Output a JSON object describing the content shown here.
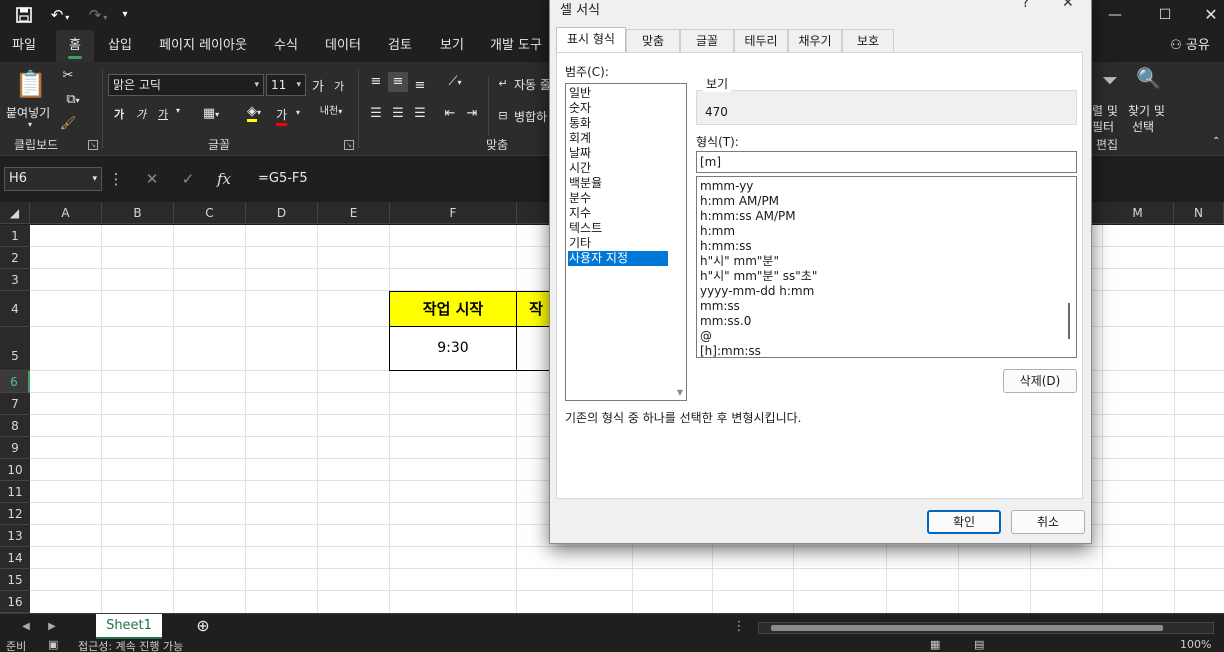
{
  "quick_access": {
    "save_icon": "save-icon",
    "undo_icon": "undo-icon",
    "redo_icon": "redo-icon",
    "customize_icon": "chevron-down-icon"
  },
  "ribbon_tabs": [
    "파일",
    "홈",
    "삽입",
    "페이지 레이아웃",
    "수식",
    "데이터",
    "검토",
    "보기",
    "개발 도구"
  ],
  "share_label": "공유",
  "clipboard": {
    "paste_label": "붙여넣기",
    "group_label": "클립보드"
  },
  "font": {
    "name": "맑은 고딕",
    "size": "11",
    "grow": "가",
    "shrink": "가",
    "bold": "가",
    "italic": "가",
    "underline": "가",
    "red_text": "가",
    "group_label": "글꼴"
  },
  "alignment": {
    "wrap_label": "자동 줄",
    "merge_label": "병합하",
    "group_label": "맞춤"
  },
  "editing": {
    "sort_filter": "렬 및",
    "filter_sub": "필터",
    "find_select": "찾기 및",
    "select_sub": "선택",
    "group_label": "편집"
  },
  "formula_bar": {
    "name_box": "H6",
    "cancel": "✕",
    "enter": "✓",
    "fx": "fx",
    "formula": "=G5-F5"
  },
  "columns": [
    "A",
    "B",
    "C",
    "D",
    "E",
    "F",
    "",
    "",
    "",
    "",
    "",
    "",
    "",
    "",
    "M",
    "N"
  ],
  "rows": [
    "1",
    "2",
    "3",
    "4",
    "5",
    "6",
    "7",
    "8",
    "9",
    "10",
    "11",
    "12",
    "13",
    "14",
    "15",
    "16"
  ],
  "cells": {
    "f4": "작업 시작",
    "g4_partial": "작",
    "f5": "9:30"
  },
  "sheet_tabs": [
    "Sheet1"
  ],
  "status": {
    "ready": "준비",
    "accessibility": "접근성: 계속 진행 가능",
    "zoom": "100%"
  },
  "dialog": {
    "title": "셀 서식",
    "help": "?",
    "close": "✕",
    "tabs": [
      "표시 형식",
      "맞춤",
      "글꼴",
      "테두리",
      "채우기",
      "보호"
    ],
    "category_label": "범주(C):",
    "categories": [
      "일반",
      "숫자",
      "통화",
      "회계",
      "날짜",
      "시간",
      "백분율",
      "분수",
      "지수",
      "텍스트",
      "기타",
      "사용자 지정"
    ],
    "selected_category": 11,
    "preview_label": "보기",
    "preview_value": "470",
    "format_label": "형식(T):",
    "format_value": "[m]",
    "formats": [
      "mmm-yy",
      "h:mm AM/PM",
      "h:mm:ss AM/PM",
      "h:mm",
      "h:mm:ss",
      "h\"시\" mm\"분\"",
      "h\"시\" mm\"분\" ss\"초\"",
      "yyyy-mm-dd h:mm",
      "mm:ss",
      "mm:ss.0",
      "@",
      "[h]:mm:ss"
    ],
    "delete_button": "삭제(D)",
    "hint": "기존의 형식 중 하나를 선택한 후 변형시킵니다.",
    "ok_button": "확인",
    "cancel_button": "취소"
  },
  "colors": {
    "accent_green": "#3a9f5f",
    "selection_blue": "#0078d7",
    "highlight_yellow": "#ffff00",
    "excel_green": "#217346"
  }
}
